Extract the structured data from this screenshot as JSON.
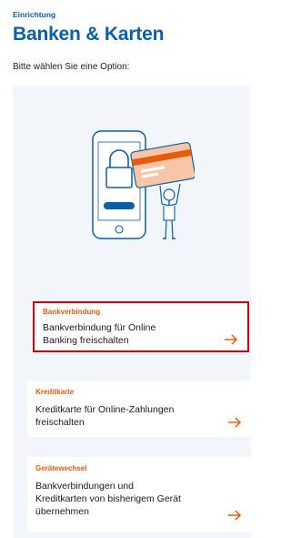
{
  "header": {
    "eyebrow": "Einrichtung",
    "title": "Banken & Karten",
    "subtitle": "Bitte wählen Sie eine Option:"
  },
  "options": [
    {
      "eyebrow": "Bankverbindung",
      "line1": "Bankverbindung für Online",
      "line2": "Banking freischalten",
      "selected": true
    },
    {
      "eyebrow": "Kreditkarte",
      "line1": "Kreditkarte für Online-Zahlungen",
      "line2": "freischalten",
      "selected": false
    },
    {
      "eyebrow": "Gerätewechsel",
      "line1": "Bankverbindungen und",
      "line2": "Kreditkarten von bisherigem Gerät",
      "line3": "übernehmen",
      "selected": false
    }
  ],
  "icons": {
    "illustration": "phone-lock-card-illustration",
    "arrow": "arrow-right-icon"
  },
  "colors": {
    "brand_blue": "#0b5ea8",
    "accent_orange": "#e85b0e",
    "selected_border": "#d7000f",
    "panel_bg": "#f2f5f9"
  }
}
